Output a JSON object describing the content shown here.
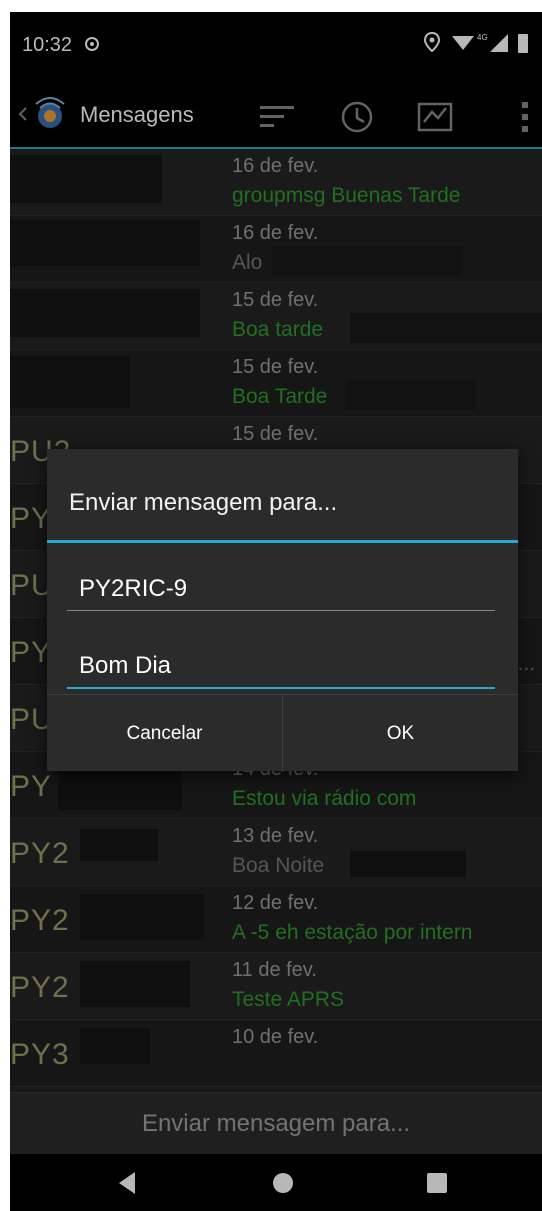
{
  "status_bar": {
    "time": "10:32"
  },
  "app_bar": {
    "title": "Mensagens"
  },
  "messages": [
    {
      "sender": "",
      "date": "16 de fev.",
      "text": "groupmsg Buenas Tarde",
      "gray": false
    },
    {
      "sender": "",
      "date": "16 de fev.",
      "text": "Alo",
      "gray": true
    },
    {
      "sender": "",
      "date": "15 de fev.",
      "text": "Boa tarde",
      "gray": false
    },
    {
      "sender": "",
      "date": "15 de fev.",
      "text": "Boa Tarde",
      "gray": false
    },
    {
      "sender": "PU2",
      "date": "15 de fev.",
      "text": "",
      "gray": false
    },
    {
      "sender": "PY",
      "date": "",
      "text": "",
      "gray": false
    },
    {
      "sender": "PU",
      "date": "",
      "text": "",
      "gray": false
    },
    {
      "sender": "PY",
      "date": "",
      "text": "e...",
      "gray": false
    },
    {
      "sender": "PU",
      "date": "",
      "text": "",
      "gray": false
    },
    {
      "sender": "PY",
      "date": "14 de fev.",
      "text": "Estou via rádio com",
      "gray": false
    },
    {
      "sender": "PY2",
      "date": "13 de fev.",
      "text": "Boa Noite",
      "gray": true
    },
    {
      "sender": "PY2",
      "date": "12 de fev.",
      "text": "A -5 eh estação por intern",
      "gray": false
    },
    {
      "sender": "PY2",
      "date": "11 de fev.",
      "text": "Teste APRS",
      "gray": false
    },
    {
      "sender": "PY3",
      "date": "10 de fev.",
      "text": "",
      "gray": false
    }
  ],
  "send_bar": {
    "label": "Enviar mensagem para..."
  },
  "dialog": {
    "title": "Enviar mensagem para...",
    "callsign_value": "PY2RIC-9",
    "message_value": "Bom Dia",
    "cancel_label": "Cancelar",
    "ok_label": "OK"
  },
  "colors": {
    "accent": "#2aa7cf",
    "message_green": "#2f9a2f",
    "sender_olive": "#9b9b6a"
  }
}
